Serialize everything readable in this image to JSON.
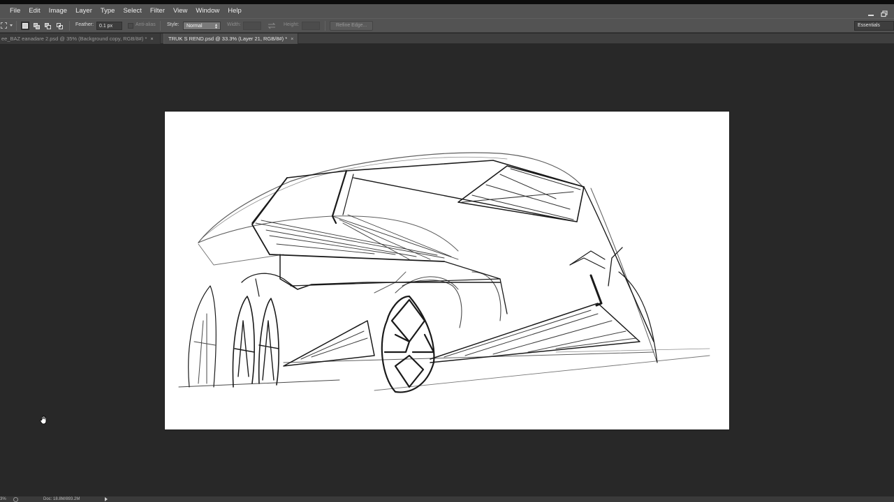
{
  "menubar": {
    "items": [
      "File",
      "Edit",
      "Image",
      "Layer",
      "Type",
      "Select",
      "Filter",
      "View",
      "Window",
      "Help"
    ]
  },
  "options_bar": {
    "feather_label": "Feather:",
    "feather_value": "0.1 px",
    "antialias_label": "Anti-alias",
    "style_label": "Style:",
    "style_value": "Normal",
    "width_label": "Width:",
    "height_label": "Height:",
    "refine_edge_label": "Refine Edge...",
    "workspace_label": "Essentials"
  },
  "tabs": [
    {
      "label": "ee_BAZ eanadare 2.psd @ 35% (Background copy, RGB/8#) *",
      "active": false
    },
    {
      "label": "TRUK S REND.psd @ 33.3% (Layer 21, RGB/8#) *",
      "active": true
    }
  ],
  "statusbar": {
    "zoom": "3%",
    "doc_info": "Doc: 18.8M/893.2M"
  },
  "icons": {
    "marquee_tool": "rectangular-marquee-icon",
    "new_selection": "new-selection-icon",
    "add_selection": "add-to-selection-icon",
    "subtract_selection": "subtract-from-selection-icon",
    "intersect_selection": "intersect-selection-icon",
    "swap": "swap-width-height-icon",
    "cursor": "grab-hand-cursor-icon"
  },
  "colors": {
    "workspace_bg": "#282828",
    "panel_bg": "#535353",
    "canvas_bg": "#ffffff"
  }
}
